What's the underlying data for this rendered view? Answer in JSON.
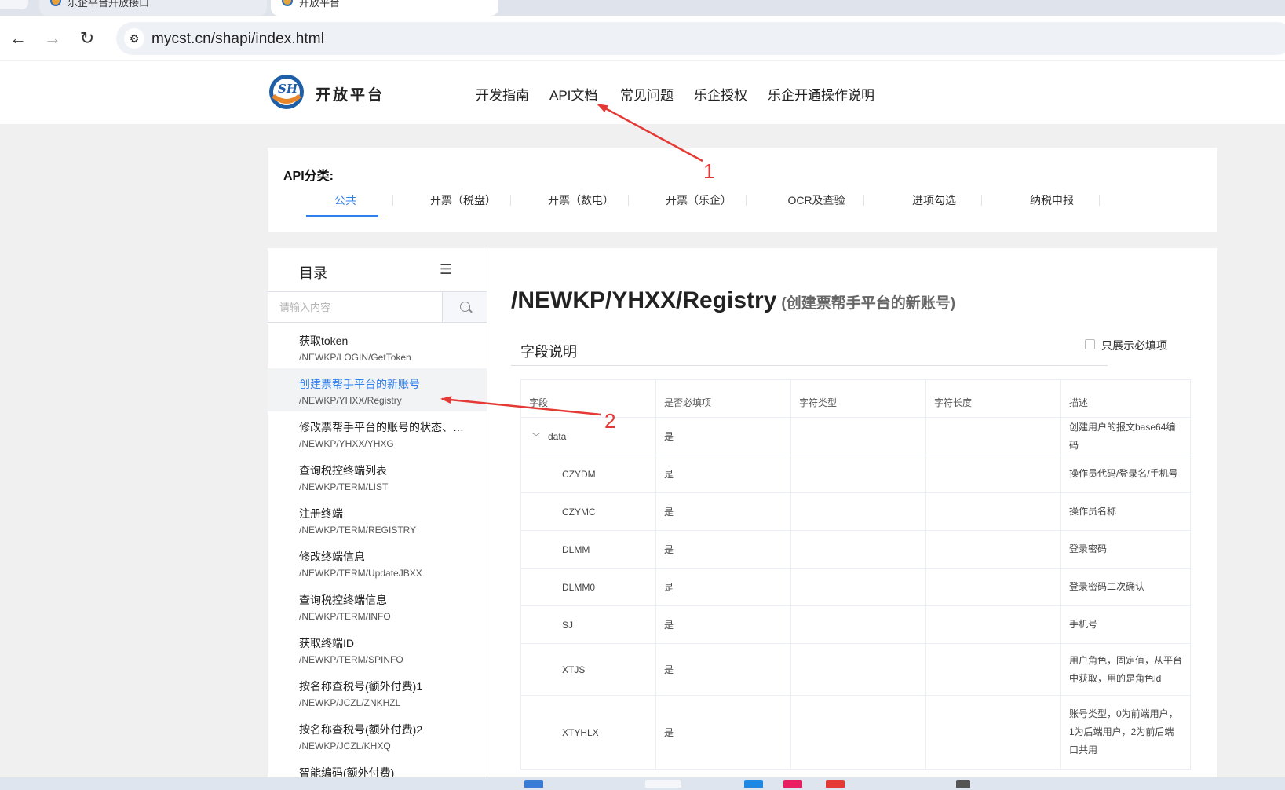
{
  "browser": {
    "tabs": [
      {
        "title": "乐企平台开放接口"
      },
      {
        "title": "开放平台"
      }
    ],
    "url": "mycst.cn/shapi/index.html",
    "back_icon": "←",
    "forward_icon": "→",
    "reload_icon": "↻",
    "site_info_icon": "⚙"
  },
  "site": {
    "brand": "开放平台",
    "nav": [
      "开发指南",
      "API文档",
      "常见问题",
      "乐企授权",
      "乐企开通操作说明"
    ]
  },
  "categories": {
    "title": "API分类:",
    "tabs": [
      "公共",
      "开票（税盘）",
      "开票（数电）",
      "开票（乐企）",
      "OCR及查验",
      "进项勾选",
      "纳税申报"
    ],
    "active_index": 0
  },
  "sidebar": {
    "title": "目录",
    "filter_icon": "☰",
    "search_placeholder": "请输入内容",
    "items": [
      {
        "name": "获取token",
        "path": "/NEWKP/LOGIN/GetToken"
      },
      {
        "name": "创建票帮手平台的新账号",
        "path": "/NEWKP/YHXX/Registry"
      },
      {
        "name": "修改票帮手平台的账号的状态、…",
        "path": "/NEWKP/YHXX/YHXG"
      },
      {
        "name": "查询税控终端列表",
        "path": "/NEWKP/TERM/LIST"
      },
      {
        "name": "注册终端",
        "path": "/NEWKP/TERM/REGISTRY"
      },
      {
        "name": "修改终端信息",
        "path": "/NEWKP/TERM/UpdateJBXX"
      },
      {
        "name": "查询税控终端信息",
        "path": "/NEWKP/TERM/INFO"
      },
      {
        "name": "获取终端ID",
        "path": "/NEWKP/TERM/SPINFO"
      },
      {
        "name": "按名称查税号(额外付费)1",
        "path": "/NEWKP/JCZL/ZNKHZL"
      },
      {
        "name": "按名称查税号(额外付费)2",
        "path": "/NEWKP/JCZL/KHXQ"
      },
      {
        "name": "智能编码(额外付费)",
        "path": ""
      }
    ],
    "active_index": 1
  },
  "content": {
    "path": "/NEWKP/YHXX/Registry",
    "subtitle": "(创建票帮手平台的新账号)",
    "section_title": "字段说明",
    "required_only_label": "只展示必填项",
    "table": {
      "headers": [
        "字段",
        "是否必填项",
        "字符类型",
        "字符长度",
        "描述"
      ],
      "rows": [
        {
          "field": "data",
          "required": "是",
          "type": "",
          "length": "",
          "desc": "创建用户的报文base64编码",
          "parent": true
        },
        {
          "field": "CZYDM",
          "required": "是",
          "type": "",
          "length": "",
          "desc": "操作员代码/登录名/手机号"
        },
        {
          "field": "CZYMC",
          "required": "是",
          "type": "",
          "length": "",
          "desc": "操作员名称"
        },
        {
          "field": "DLMM",
          "required": "是",
          "type": "",
          "length": "",
          "desc": "登录密码"
        },
        {
          "field": "DLMM0",
          "required": "是",
          "type": "",
          "length": "",
          "desc": "登录密码二次确认"
        },
        {
          "field": "SJ",
          "required": "是",
          "type": "",
          "length": "",
          "desc": "手机号"
        },
        {
          "field": "XTJS",
          "required": "是",
          "type": "",
          "length": "",
          "desc": "用户角色，固定值，从平台中获取，用的是角色id"
        },
        {
          "field": "XTYHLX",
          "required": "是",
          "type": "",
          "length": "",
          "desc": "账号类型，0为前端用户，1为后端用户，2为前后端口共用"
        }
      ]
    }
  },
  "annotations": [
    "1",
    "2"
  ],
  "colors": {
    "accent": "#2f80ed",
    "annotation": "#e53935"
  }
}
